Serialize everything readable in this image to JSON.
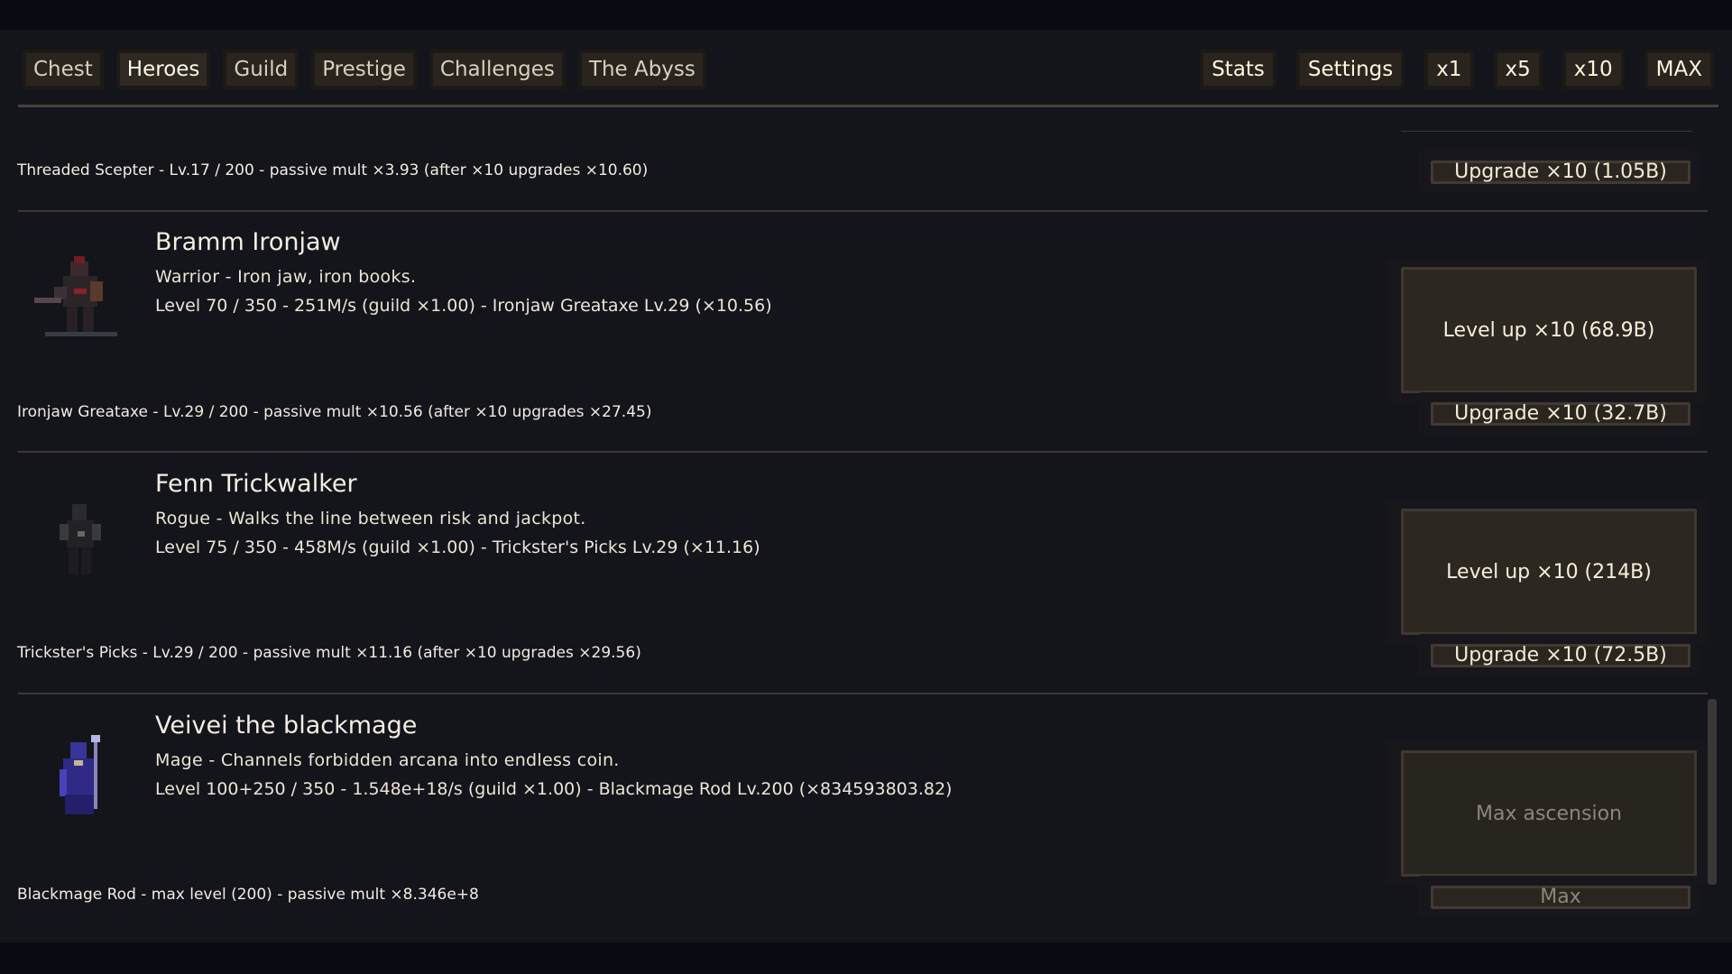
{
  "nav": {
    "tabs": [
      "Chest",
      "Heroes",
      "Guild",
      "Prestige",
      "Challenges",
      "The Abyss"
    ],
    "active_tab": "Heroes",
    "controls": {
      "stats": "Stats",
      "settings": "Settings",
      "x1": "x1",
      "x5": "x5",
      "x10": "x10",
      "max": "MAX"
    }
  },
  "top_weapon": {
    "text": "Threaded Scepter - Lv.17 / 200 - passive mult ×3.93 (after ×10 upgrades ×10.60)",
    "button": "Upgrade ×10 (1.05B)"
  },
  "heroes": [
    {
      "name": "Bramm Ironjaw",
      "description": "Warrior - Iron jaw, iron books.",
      "stats": "Level 70 / 350 - 251M/s (guild ×1.00) - Ironjaw Greataxe Lv.29 (×10.56)",
      "level_button": "Level up ×10 (68.9B)",
      "level_disabled": false,
      "weapon_text": "Ironjaw Greataxe - Lv.29 / 200 - passive mult ×10.56 (after ×10 upgrades ×27.45)",
      "weapon_button": "Upgrade ×10 (32.7B)",
      "weapon_disabled": false,
      "sprite": "warrior"
    },
    {
      "name": "Fenn Trickwalker",
      "description": "Rogue - Walks the line between risk and jackpot.",
      "stats": "Level 75 / 350 - 458M/s (guild ×1.00) - Trickster's Picks Lv.29 (×11.16)",
      "level_button": "Level up ×10 (214B)",
      "level_disabled": false,
      "weapon_text": "Trickster's Picks - Lv.29 / 200 - passive mult ×11.16 (after ×10 upgrades ×29.56)",
      "weapon_button": "Upgrade ×10 (72.5B)",
      "weapon_disabled": false,
      "sprite": "rogue"
    },
    {
      "name": "Veivei the blackmage",
      "description": "Mage - Channels forbidden arcana into endless coin.",
      "stats": "Level 100+250 / 350 - 1.548e+18/s (guild ×1.00) - Blackmage Rod Lv.200 (×834593803.82)",
      "level_button": "Max ascension",
      "level_disabled": true,
      "weapon_text": "Blackmage Rod - max level (200) - passive mult ×8.346e+8",
      "weapon_button": "Max",
      "weapon_disabled": true,
      "sprite": "mage"
    }
  ]
}
